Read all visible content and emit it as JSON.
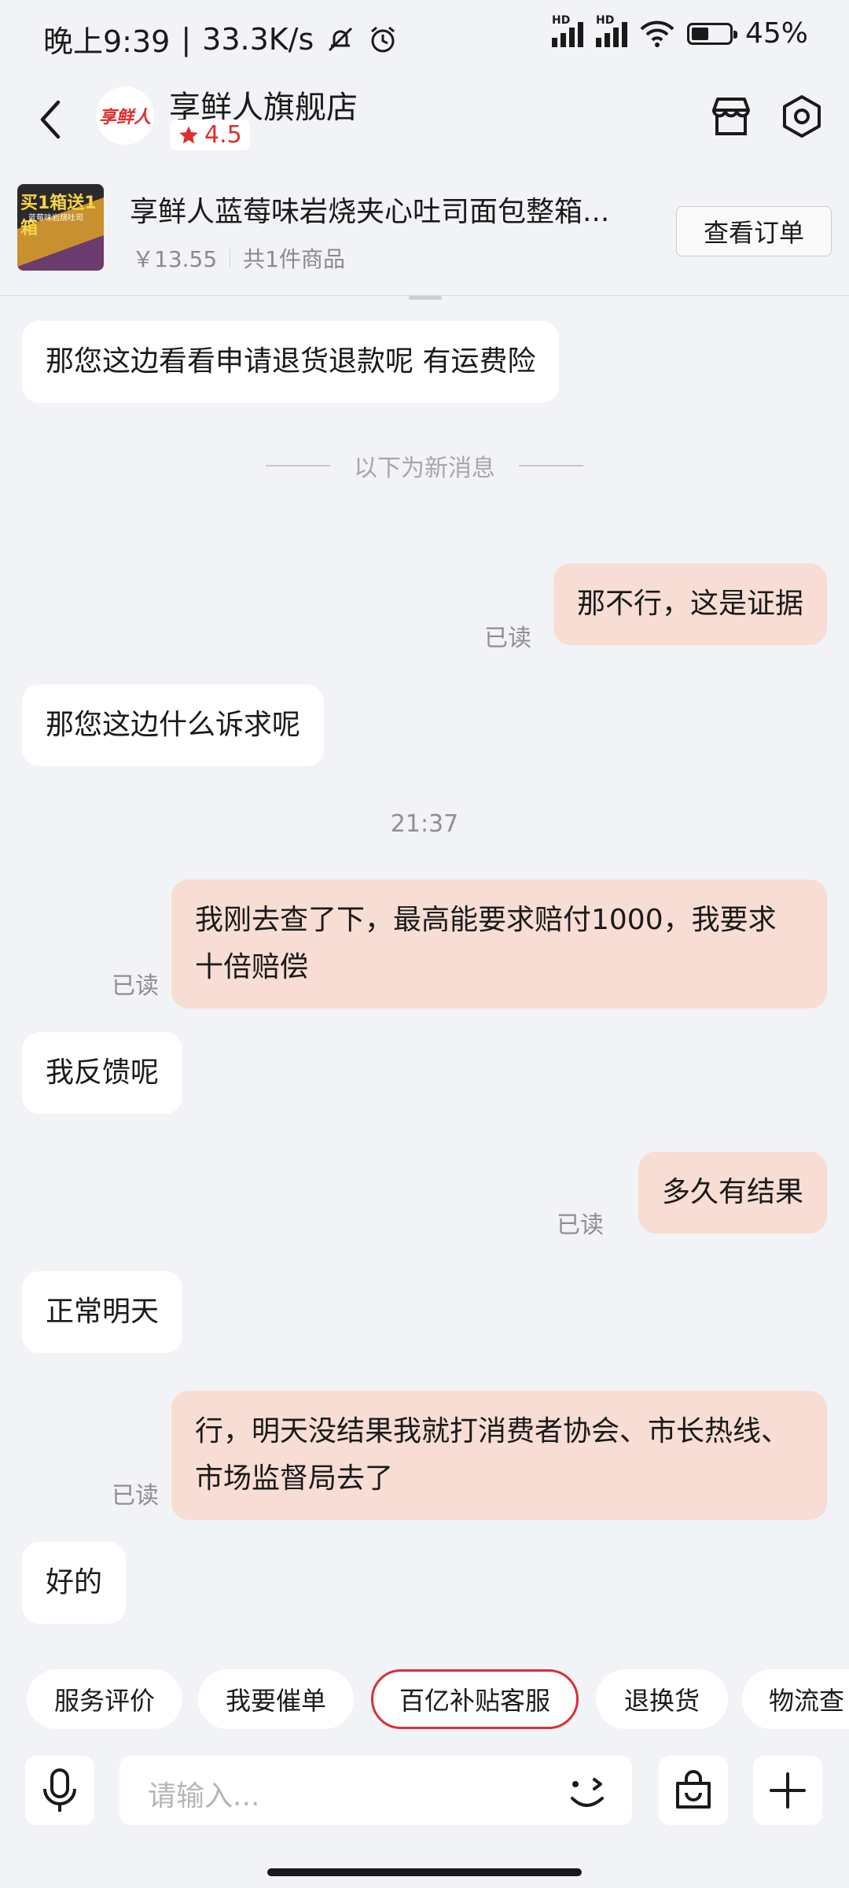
{
  "status_bar": {
    "time": "晚上9:39",
    "speed": "33.3K/s",
    "hd1": "HD",
    "hd2": "HD",
    "battery_percent_text": "45%",
    "battery_level": 0.45
  },
  "header": {
    "shop_name": "享鲜人旗舰店",
    "rating": "4.5",
    "avatar_text": "享鲜人",
    "accent_color": "#e02d2d"
  },
  "product": {
    "image_text1": "买1箱送1箱",
    "image_text2": "蓝莓味岩烧吐司",
    "title": "享鲜人蓝莓味岩烧夹心吐司面包整箱...",
    "price": "￥13.55",
    "count": "共1件商品",
    "order_button": "查看订单"
  },
  "chat": {
    "divider": "以下为新消息",
    "read_label": "已读",
    "time_stamp": "21:37",
    "messages": [
      {
        "side": "in",
        "text": "那您这边看看申请退货退款呢 有运费险"
      },
      {
        "side": "out",
        "text": "那不行，这是证据"
      },
      {
        "side": "in",
        "text": "那您这边什么诉求呢"
      },
      {
        "side": "out",
        "text": "我刚去查了下，最高能要求赔付1000，我要求十倍赔偿"
      },
      {
        "side": "in",
        "text": "我反馈呢"
      },
      {
        "side": "out",
        "text": "多久有结果"
      },
      {
        "side": "in",
        "text": "正常明天"
      },
      {
        "side": "out",
        "text": "行，明天没结果我就打消费者协会、市长热线、市场监督局去了"
      },
      {
        "side": "in",
        "text": "好的"
      }
    ]
  },
  "quick_replies": [
    "服务评价",
    "我要催单",
    "百亿补贴客服",
    "退换货",
    "物流查"
  ],
  "input": {
    "placeholder": "请输入..."
  }
}
